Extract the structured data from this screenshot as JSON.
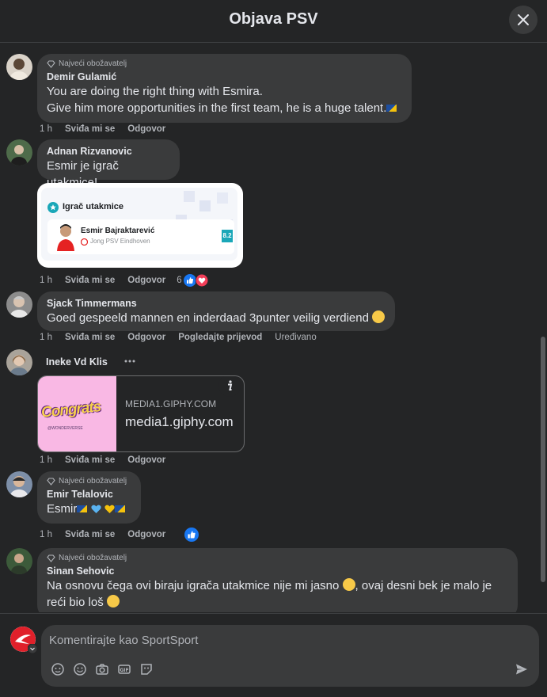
{
  "header": {
    "title": "Objava PSV"
  },
  "badge_label": "Najveći obožavatelj",
  "comments": [
    {
      "author": "Demir Gulamić",
      "lines": [
        "You are doing the right thing with Esmira.",
        "Give him more opportunities in the first team, he is a huge talent."
      ],
      "time": "1 h",
      "like": "Sviđa mi se",
      "reply": "Odgovor"
    },
    {
      "author": "Adnan Rizvanovic",
      "lines": [
        "Esmir je igrač utakmice!"
      ],
      "time": "1 h",
      "like": "Sviđa mi se",
      "reply": "Odgovor",
      "reactions_count": "6",
      "card": {
        "title": "Igrač utakmice",
        "player": "Esmir Bajraktarević",
        "team": "Jong PSV Eindhoven",
        "rating": "8.2"
      }
    },
    {
      "author": "Sjack Timmermans",
      "lines": [
        "Goed gespeeld mannen en inderdaad 3punter veilig verdiend"
      ],
      "time": "1 h",
      "like": "Sviđa mi se",
      "reply": "Odgovor",
      "translate": "Pogledajte prijevod",
      "edited": "Uređivano"
    },
    {
      "author": "Ineke Vd Klis",
      "time": "1 h",
      "like": "Sviđa mi se",
      "reply": "Odgovor",
      "link": {
        "domain": "MEDIA1.GIPHY.COM",
        "title": "media1.giphy.com",
        "gif_text": "Congrats",
        "gif_sub": "@WONDERVERSE"
      }
    },
    {
      "author": "Emir Telalovic",
      "lines": [
        "Esmir"
      ],
      "time": "1 h",
      "like": "Sviđa mi se",
      "reply": "Odgovor"
    },
    {
      "author": "Sinan Sehovic",
      "lines": [
        "Na osnovu čega ovi biraju igrača utakmice nije mi jasno",
        ", ovaj desni bek je malo je",
        "reći bio loš"
      ]
    }
  ],
  "composer": {
    "placeholder": "Komentirajte kao SportSport"
  },
  "colors": {
    "background": "#242526",
    "bubble": "#3a3b3c",
    "text": "#e4e6eb",
    "secondary": "#b0b3b8",
    "like_blue": "#1877f2",
    "love_red": "#f33e58"
  },
  "icons": [
    "close-icon",
    "diamond-icon",
    "like-reaction-icon",
    "love-reaction-icon",
    "more-icon",
    "info-icon",
    "avatar-icon",
    "emoji-icon",
    "camera-icon",
    "gif-icon",
    "sticker-icon",
    "send-icon"
  ]
}
